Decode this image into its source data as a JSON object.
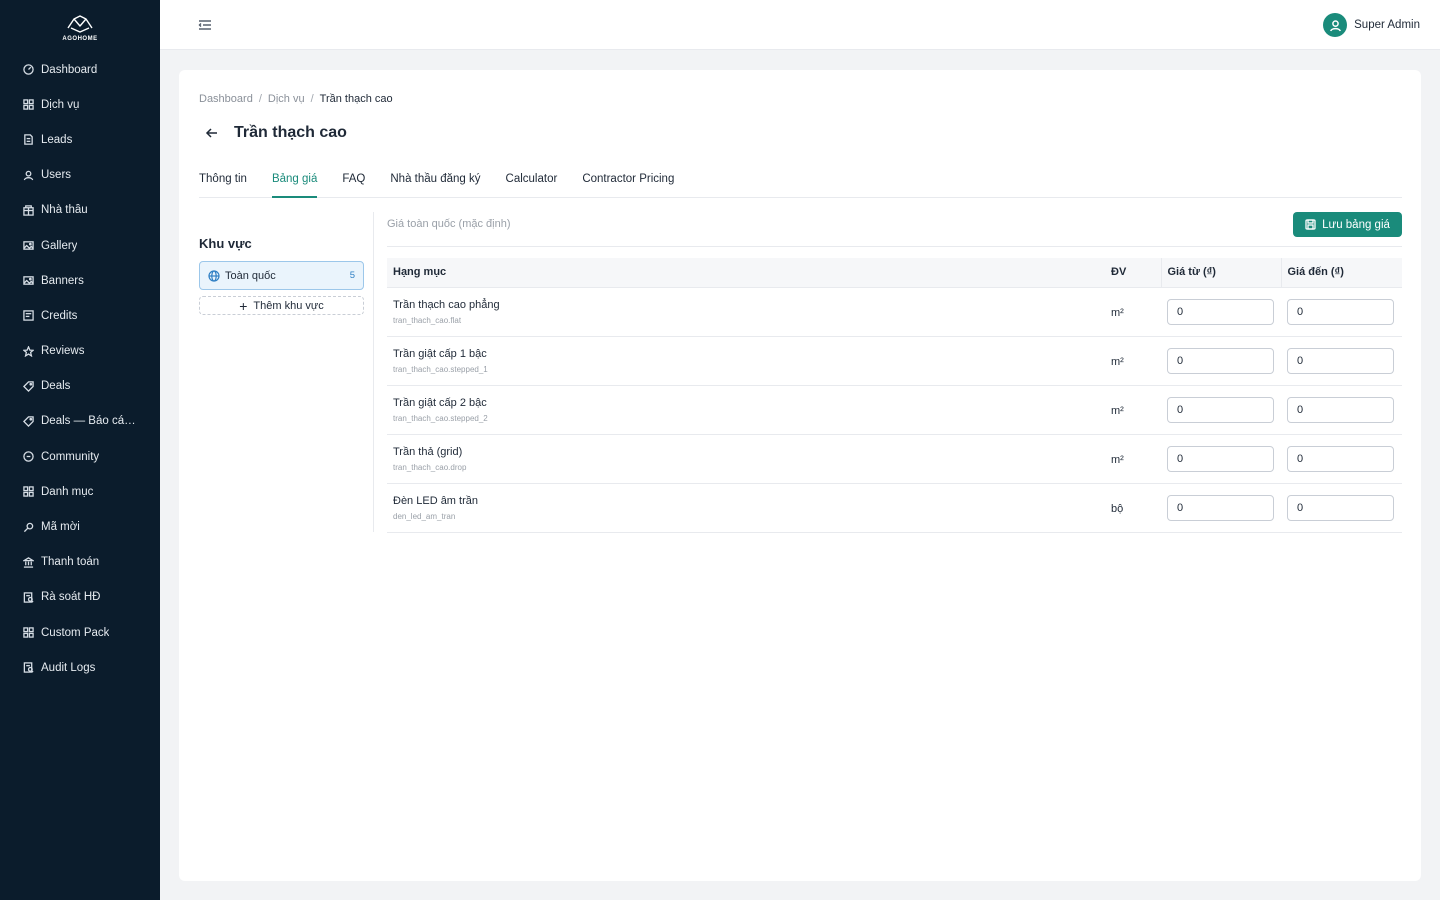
{
  "brand": {
    "logo_text": "AGOHOME",
    "accent": "#1a8b7b",
    "sidebar_bg": "#0b1c2c"
  },
  "sidebar": {
    "items": [
      {
        "label": "Dashboard",
        "icon": "dashboard-icon"
      },
      {
        "label": "Dịch vụ",
        "icon": "grid-icon"
      },
      {
        "label": "Leads",
        "icon": "document-icon"
      },
      {
        "label": "Users",
        "icon": "user-icon"
      },
      {
        "label": "Nhà thầu",
        "icon": "building-icon"
      },
      {
        "label": "Gallery",
        "icon": "image-icon"
      },
      {
        "label": "Banners",
        "icon": "image-icon"
      },
      {
        "label": "Credits",
        "icon": "card-icon"
      },
      {
        "label": "Reviews",
        "icon": "star-icon"
      },
      {
        "label": "Deals",
        "icon": "tag-icon"
      },
      {
        "label": "Deals — Báo cáo ...",
        "icon": "tag-icon"
      },
      {
        "label": "Community",
        "icon": "chat-icon"
      },
      {
        "label": "Danh mục",
        "icon": "grid-icon"
      },
      {
        "label": "Mã mời",
        "icon": "key-icon"
      },
      {
        "label": "Thanh toán",
        "icon": "bank-icon"
      },
      {
        "label": "Rà soát HĐ",
        "icon": "audit-icon"
      },
      {
        "label": "Custom Pack",
        "icon": "grid-icon"
      },
      {
        "label": "Audit Logs",
        "icon": "audit-icon"
      }
    ]
  },
  "header": {
    "user_name": "Super Admin"
  },
  "breadcrumb": {
    "root": "Dashboard",
    "section": "Dịch vụ",
    "current": "Trần thạch cao"
  },
  "page": {
    "title": "Trần thạch cao"
  },
  "tabs": [
    {
      "label": "Thông tin",
      "active": false
    },
    {
      "label": "Bảng giá",
      "active": true
    },
    {
      "label": "FAQ",
      "active": false
    },
    {
      "label": "Nhà thầu đăng ký",
      "active": false
    },
    {
      "label": "Calculator",
      "active": false
    },
    {
      "label": "Contractor Pricing",
      "active": false
    }
  ],
  "regions": {
    "title": "Khu vực",
    "items": [
      {
        "name": "Toàn quốc",
        "count": "5"
      }
    ],
    "add_label": "Thêm khu vực"
  },
  "pricing": {
    "scope_label": "Giá toàn quốc (mặc định)",
    "save_label": "Lưu bảng giá",
    "columns": {
      "item": "Hạng mục",
      "unit": "ĐV",
      "price_from": "Giá từ (₫)",
      "price_to": "Giá đến (₫)"
    },
    "rows": [
      {
        "name": "Trần thạch cao phẳng",
        "code": "tran_thach_cao.flat",
        "unit": "m²",
        "price_from": "0",
        "price_to": "0"
      },
      {
        "name": "Trần giật cấp 1 bậc",
        "code": "tran_thach_cao.stepped_1",
        "unit": "m²",
        "price_from": "0",
        "price_to": "0"
      },
      {
        "name": "Trần giật cấp 2 bậc",
        "code": "tran_thach_cao.stepped_2",
        "unit": "m²",
        "price_from": "0",
        "price_to": "0"
      },
      {
        "name": "Trần thả (grid)",
        "code": "tran_thach_cao.drop",
        "unit": "m²",
        "price_from": "0",
        "price_to": "0"
      },
      {
        "name": "Đèn LED âm trần",
        "code": "den_led_am_tran",
        "unit": "bộ",
        "price_from": "0",
        "price_to": "0"
      }
    ]
  }
}
